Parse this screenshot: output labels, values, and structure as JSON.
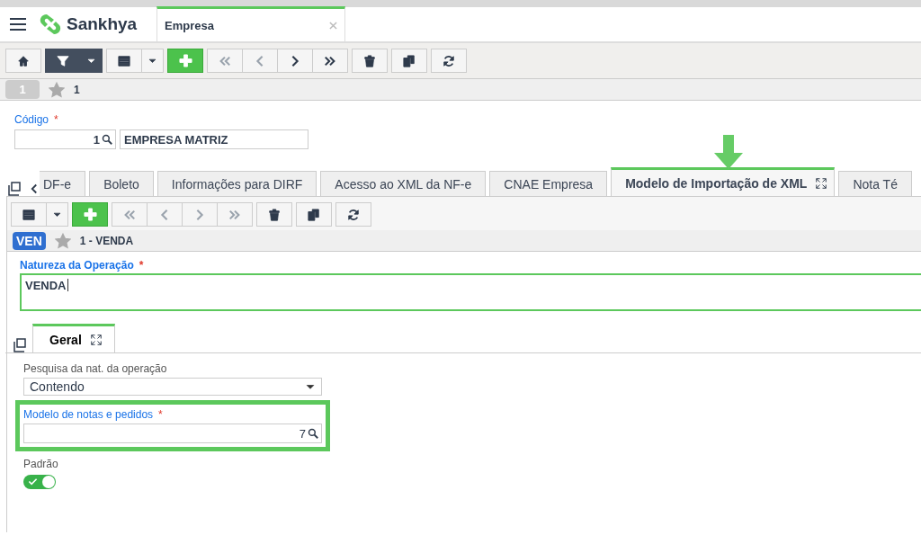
{
  "header": {
    "brand": "Sankhya",
    "tab": {
      "title": "Empresa",
      "selected": true
    }
  },
  "toolbar": [
    {
      "kind": "home"
    },
    {
      "kind": "filter",
      "active": true
    },
    {
      "kind": "grid"
    },
    {
      "kind": "add"
    },
    {
      "kind": "first",
      "disabled": true
    },
    {
      "kind": "prev",
      "disabled": true
    },
    {
      "kind": "next",
      "disabled": false
    },
    {
      "kind": "last",
      "disabled": false
    },
    {
      "kind": "delete"
    },
    {
      "kind": "copy"
    },
    {
      "kind": "refresh"
    }
  ],
  "record_bar": {
    "badge": "1",
    "title": "1"
  },
  "codigo": {
    "label": "Código",
    "required_mark": "*",
    "value": "1",
    "description": "EMPRESA MATRIZ"
  },
  "tabs": [
    {
      "label": "DF-e",
      "selected": false
    },
    {
      "label": "Boleto",
      "selected": false
    },
    {
      "label": "Informações para DIRF",
      "selected": false
    },
    {
      "label": "Acesso ao XML da NF-e",
      "selected": false
    },
    {
      "label": "CNAE Empresa",
      "selected": false
    },
    {
      "label": "Modelo de Importação de XML",
      "selected": true
    },
    {
      "label": "Nota Té",
      "selected": false
    }
  ],
  "sub_toolbar": [
    {
      "kind": "grid"
    },
    {
      "kind": "add"
    },
    {
      "kind": "first",
      "disabled": true
    },
    {
      "kind": "prev",
      "disabled": true
    },
    {
      "kind": "next",
      "disabled": true
    },
    {
      "kind": "last",
      "disabled": true
    },
    {
      "kind": "delete"
    },
    {
      "kind": "copy"
    },
    {
      "kind": "refresh"
    }
  ],
  "sub_record": {
    "badge": "VEN",
    "title": "1 - VENDA"
  },
  "natureza": {
    "label": "Natureza da Operação",
    "required_mark": "*",
    "value": "VENDA"
  },
  "inner_tabs": [
    {
      "label": "Geral",
      "selected": true
    }
  ],
  "fields": [
    {
      "kind": "select",
      "label": "Pesquisa da nat. da operação",
      "value": "Contendo"
    },
    {
      "kind": "lookup",
      "label": "Modelo de notas e pedidos",
      "required_mark": "*",
      "value": "7",
      "highlighted": true
    },
    {
      "kind": "switch",
      "label": "Padrão",
      "on": true
    }
  ]
}
